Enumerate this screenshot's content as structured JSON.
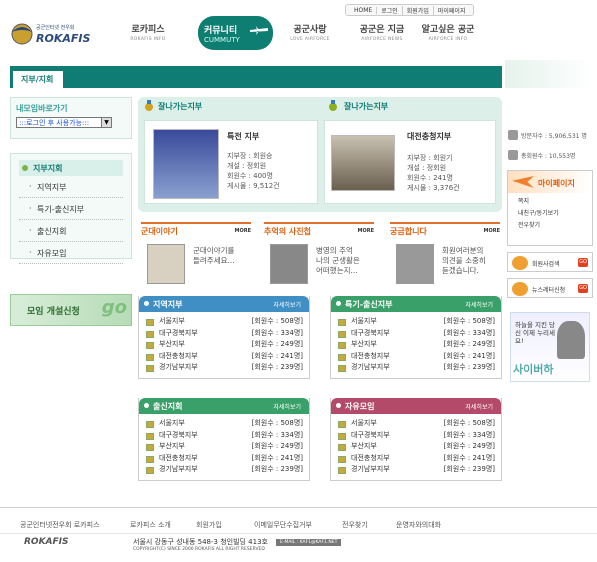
{
  "header": {
    "topnav": [
      "HOME",
      "로그인",
      "회원가입",
      "마이페이지"
    ],
    "logo_text": "공군인터넷 전우회",
    "logo_brand": "ROKAFIS",
    "nav": [
      {
        "ko": "로카피스",
        "en": "ROKAFIS INFO"
      },
      {
        "ko": "커뮤니티",
        "en": "CUMMUTY"
      },
      {
        "ko": "공군사랑",
        "en": "LOVE AIRFORCE"
      },
      {
        "ko": "공군은 지금",
        "en": "AIRFORCE NEWS"
      },
      {
        "ko": "알고싶은 공군",
        "en": "AIRFORCE INFO"
      }
    ]
  },
  "page_title": "지부/지회",
  "left": {
    "join_heading": "내모임바로가기",
    "join_select": ":::로그인 후 사용가능:::",
    "branch_heading": "지부지회",
    "branch_items": [
      "지역지부",
      "특기-출신지부",
      "출신지회",
      "자유모임"
    ],
    "open_button": "모임 개설신청",
    "open_go": "go"
  },
  "featured": {
    "heading_left": "잘나가는지부",
    "heading_right": "잘나가는지부",
    "cards": [
      {
        "name": "특전 지부",
        "lines": [
          "지부장 : 회원승",
          "개설 : 정회원",
          "회원수 : 400명",
          "게시물 : 9,512건"
        ]
      },
      {
        "name": "대전충청지부",
        "lines": [
          "지부장 : 회원기",
          "개설 : 정회원",
          "회원수 : 241명",
          "게시물 : 3,376건"
        ]
      }
    ]
  },
  "middle": [
    {
      "title": "군대이야기",
      "more": "MORE",
      "text": "군대이야기를 들려주세요...",
      "color": "#e06010"
    },
    {
      "title": "추억의 사진첩",
      "more": "MORE",
      "text": "병영의 추억 나의 군생활은 어떠했는지...",
      "color": "#e06010"
    },
    {
      "title": "궁금합니다",
      "more": "MORE",
      "text": "회원여러분의 의견을 소중히 듣겠습니다.",
      "color": "#e06010"
    }
  ],
  "lists": [
    {
      "title": "지역지부",
      "detail": "자세히보기",
      "color": "#3f8fc4",
      "rows": [
        [
          "서울지부",
          "[회원수 : 508명]"
        ],
        [
          "대구경북지부",
          "[회원수 : 334명]"
        ],
        [
          "부산지부",
          "[회원수 : 249명]"
        ],
        [
          "대전충청지부",
          "[회원수 : 241명]"
        ],
        [
          "경기남부지부",
          "[회원수 : 239명]"
        ]
      ]
    },
    {
      "title": "특기-출신지부",
      "detail": "자세히보기",
      "color": "#3f8fc4",
      "rows": [
        [
          "서울지부",
          "[회원수 : 508명]"
        ],
        [
          "대구경북지부",
          "[회원수 : 334명]"
        ],
        [
          "부산지부",
          "[회원수 : 249명]"
        ],
        [
          "대전충청지부",
          "[회원수 : 241명]"
        ],
        [
          "경기남부지부",
          "[회원수 : 239명]"
        ]
      ]
    },
    {
      "title": "출신지회",
      "detail": "자세히보기",
      "color": "#3aa06a",
      "rows": [
        [
          "서울지부",
          "[회원수 : 508명]"
        ],
        [
          "대구경북지부",
          "[회원수 : 334명]"
        ],
        [
          "부산지부",
          "[회원수 : 249명]"
        ],
        [
          "대전충청지부",
          "[회원수 : 241명]"
        ],
        [
          "경기남부지부",
          "[회원수 : 239명]"
        ]
      ]
    },
    {
      "title": "자유모임",
      "detail": "자세히보기",
      "color": "#b44a6a",
      "rows": [
        [
          "서울지부",
          "[회원수 : 508명]"
        ],
        [
          "대구경북지부",
          "[회원수 : 334명]"
        ],
        [
          "부산지부",
          "[회원수 : 249명]"
        ],
        [
          "대전충청지부",
          "[회원수 : 241명]"
        ],
        [
          "경기남부지부",
          "[회원수 : 239명]"
        ]
      ]
    }
  ],
  "right": {
    "visits": "방문자수 : 5,906,531 명",
    "members": "총회원수 : 10,553명",
    "mypage_title": "마이페이지",
    "mypage_items": [
      "쪽지",
      "내친구/동기보기",
      "전우찾기"
    ],
    "btn1": "회원사검색",
    "btn2": "뉴스레터신청",
    "go": "GO",
    "banner_text": "하늘을 지킨 당신 이제 누리세요!",
    "banner_brand": "사이버하"
  },
  "footer": {
    "title": "공군인터넷전우회 로카피스",
    "links": [
      "로카피스 소개",
      "회원가입",
      "이메일무단수집거부",
      "전우찾기",
      "운영자와의대화"
    ],
    "address": "서울시 강동구 성내동 548-3 청인빌딩 413호",
    "copyright": "COPYRIGHT(C) SINCE 2000 ROKAFIS ALL RIGHT RESERVED",
    "email": "E-MAIL : KAF1@KAF1.NET"
  }
}
